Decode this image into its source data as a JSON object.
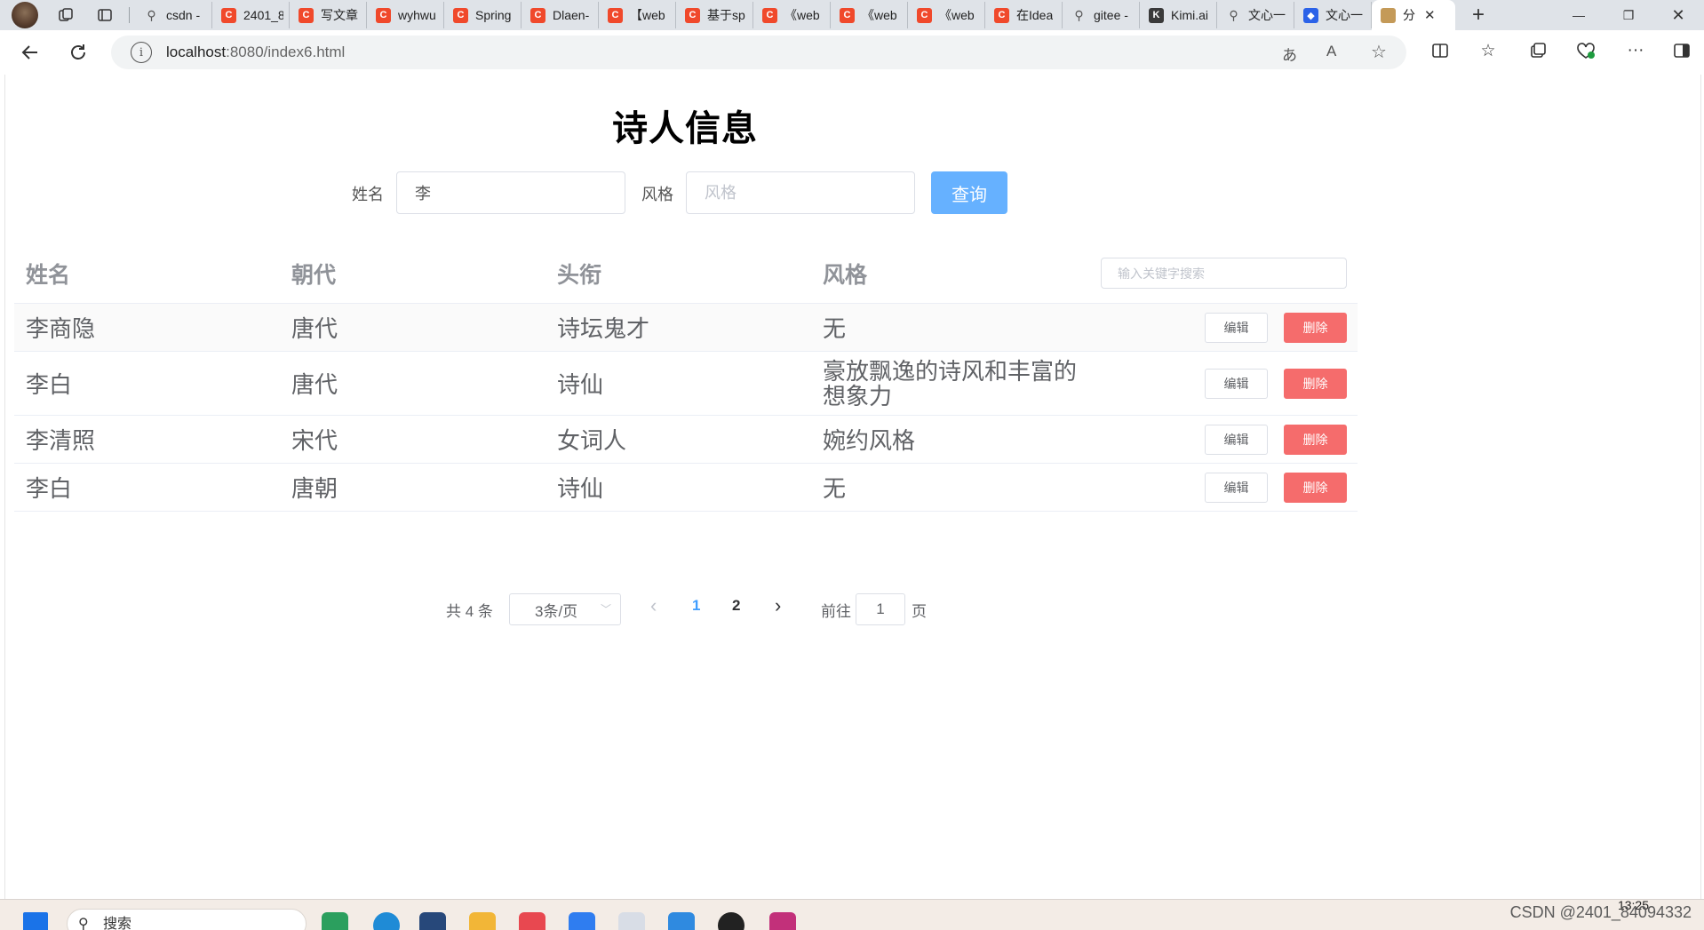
{
  "browser": {
    "tabs": [
      {
        "title": "csdn -",
        "icon": "search-icon"
      },
      {
        "title": "2401_8",
        "icon": "csdn-icon"
      },
      {
        "title": "写文章",
        "icon": "csdn-icon"
      },
      {
        "title": "wyhwu",
        "icon": "csdn-icon"
      },
      {
        "title": "Spring",
        "icon": "csdn-icon"
      },
      {
        "title": "Dlaen-",
        "icon": "csdn-icon"
      },
      {
        "title": "【web",
        "icon": "csdn-icon"
      },
      {
        "title": "基于sp",
        "icon": "csdn-icon"
      },
      {
        "title": "《web",
        "icon": "csdn-icon"
      },
      {
        "title": "《web",
        "icon": "csdn-icon"
      },
      {
        "title": "《web",
        "icon": "csdn-icon"
      },
      {
        "title": "在Idea",
        "icon": "csdn-icon"
      },
      {
        "title": "gitee -",
        "icon": "search-icon"
      },
      {
        "title": "Kimi.ai",
        "icon": "kimi-icon"
      },
      {
        "title": "文心一",
        "icon": "search-icon"
      },
      {
        "title": "文心一",
        "icon": "wenxin-icon"
      },
      {
        "title": "分",
        "icon": "page-icon"
      }
    ],
    "url_host": "localhost",
    "url_path": ":8080/index6.html"
  },
  "page": {
    "title": "诗人信息",
    "search_form": {
      "name_label": "姓名",
      "name_value": "李",
      "style_label": "风格",
      "style_placeholder": "风格",
      "query_button": "查询"
    },
    "table": {
      "headers": [
        "姓名",
        "朝代",
        "头衔",
        "风格"
      ],
      "keyword_placeholder": "输入关键字搜索",
      "edit_label": "编辑",
      "delete_label": "删除",
      "rows": [
        {
          "name": "李商隐",
          "dynasty": "唐代",
          "title": "诗坛鬼才",
          "style": "无"
        },
        {
          "name": "李白",
          "dynasty": "唐代",
          "title": "诗仙",
          "style": "豪放飘逸的诗风和丰富的想象力"
        },
        {
          "name": "李清照",
          "dynasty": "宋代",
          "title": "女词人",
          "style": "婉约风格"
        },
        {
          "name": "李白",
          "dynasty": "唐朝",
          "title": "诗仙",
          "style": "无"
        }
      ]
    },
    "pagination": {
      "total_text": "共 4 条",
      "page_size": "3条/页",
      "pages": [
        "1",
        "2"
      ],
      "current_page": "1",
      "goto_label": "前往",
      "goto_value": "1",
      "page_suffix": "页"
    }
  },
  "taskbar": {
    "search_label": "搜索",
    "watermark": "CSDN @2401_84094332",
    "time": "13:25"
  },
  "colors": {
    "primary_light": "#66b1ff",
    "danger": "#f56c6c",
    "active_page": "#409eff",
    "header_text": "#909399"
  }
}
